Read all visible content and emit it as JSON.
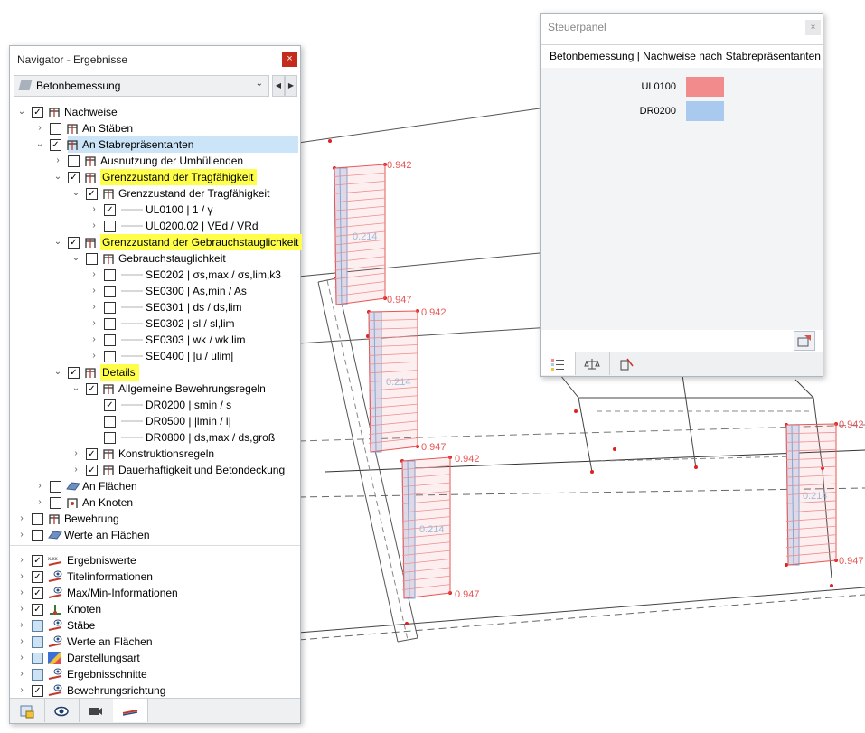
{
  "viewport": {
    "values": [
      "0.942",
      "0.214",
      "0.947",
      "0.942",
      "0.214",
      "0.947",
      "0.942",
      "0.214",
      "0.947",
      "0.942",
      "0.214",
      "0.947"
    ]
  },
  "navigator": {
    "title": "Navigator - Ergebnisse",
    "close_label": "×",
    "combo_value": "Betonbemessung",
    "combo_chevron": "⌄",
    "prev_label": "◀",
    "next_label": "▶",
    "tree": [
      {
        "label": "Nachweise",
        "expanded": true,
        "checked": true
      },
      {
        "label": "An Stäben",
        "checked": false
      },
      {
        "label": "An Stabrepräsentanten",
        "expanded": true,
        "checked": true,
        "selected": true
      },
      {
        "label": "Ausnutzung der Umhüllenden",
        "checked": false
      },
      {
        "label": "Grenzzustand der Tragfähigkeit",
        "expanded": true,
        "checked": true,
        "highlight": true
      },
      {
        "label": "Grenzzustand der Tragfähigkeit",
        "expanded": true,
        "checked": true
      },
      {
        "label": "UL0100 | 1 / γ",
        "checked": true
      },
      {
        "label": "UL0200.02 | VEd / VRd",
        "checked": false
      },
      {
        "label": "Grenzzustand der Gebrauchstauglichkeit",
        "expanded": true,
        "checked": true,
        "highlight": true
      },
      {
        "label": "Gebrauchstauglichkeit",
        "expanded": true,
        "checked": false
      },
      {
        "label": "SE0202 | σs,max / σs,lim,k3",
        "checked": false
      },
      {
        "label": "SE0300 | As,min / As",
        "checked": false
      },
      {
        "label": "SE0301 | ds / ds,lim",
        "checked": false
      },
      {
        "label": "SE0302 | sl / sl,lim",
        "checked": false
      },
      {
        "label": "SE0303 | wk / wk,lim",
        "checked": false
      },
      {
        "label": "SE0400 | |u / ulim|",
        "checked": false
      },
      {
        "label": "Details",
        "expanded": true,
        "checked": true,
        "highlight": true
      },
      {
        "label": "Allgemeine Bewehrungsregeln",
        "expanded": true,
        "checked": true
      },
      {
        "label": "DR0200 | smin / s",
        "checked": true
      },
      {
        "label": "DR0500 | |lmin / l|",
        "checked": false
      },
      {
        "label": "DR0800 | ds,max / ds,groß",
        "checked": false
      },
      {
        "label": "Konstruktionsregeln",
        "checked": true
      },
      {
        "label": "Dauerhaftigkeit und Betondeckung",
        "checked": true
      },
      {
        "label": "An Flächen",
        "checked": false
      },
      {
        "label": "An Knoten",
        "checked": false
      },
      {
        "label": "Bewehrung",
        "checked": false
      },
      {
        "label": "Werte an Flächen",
        "checked": false
      }
    ],
    "display_items": [
      {
        "label": "Ergebniswerte",
        "checked": true
      },
      {
        "label": "Titelinformationen",
        "checked": true
      },
      {
        "label": "Max/Min-Informationen",
        "checked": true
      },
      {
        "label": "Knoten",
        "checked": true
      },
      {
        "label": "Stäbe",
        "checked": false
      },
      {
        "label": "Werte an Flächen",
        "checked": false
      },
      {
        "label": "Darstellungsart",
        "checked": false
      },
      {
        "label": "Ergebnisschnitte",
        "checked": false
      },
      {
        "label": "Bewehrungsrichtung",
        "checked": true
      }
    ],
    "ico_tag": "x.xx"
  },
  "panel": {
    "title": "Steuerpanel",
    "close_label": "×",
    "subtitle": "Betonbemessung | Nachweise nach Stabrepräsentanten",
    "legend": [
      {
        "name": "UL0100",
        "color": "#f28b8b"
      },
      {
        "name": "DR0200",
        "color": "#a9c9ee"
      }
    ]
  },
  "colors": {
    "selection": "#cce4f7",
    "highlight": "#ffff4a",
    "result_red": "#e65757",
    "result_blue": "#7ea7d8"
  }
}
